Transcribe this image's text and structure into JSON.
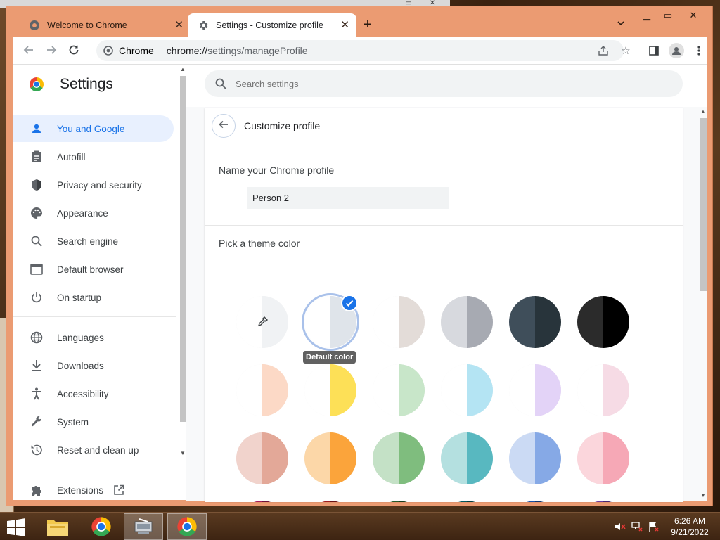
{
  "browser": {
    "tabs": [
      {
        "title": "Welcome to Chrome",
        "active": false
      },
      {
        "title": "Settings - Customize profile",
        "active": true
      }
    ],
    "omnibox": {
      "site": "Chrome",
      "url_scheme": "chrome://",
      "url_path": "settings/manageProfile"
    }
  },
  "settings": {
    "title": "Settings",
    "search_placeholder": "Search settings",
    "nav": [
      {
        "label": "You and Google",
        "icon": "person-icon",
        "selected": true
      },
      {
        "label": "Autofill",
        "icon": "clipboard-icon"
      },
      {
        "label": "Privacy and security",
        "icon": "shield-icon"
      },
      {
        "label": "Appearance",
        "icon": "palette-icon"
      },
      {
        "label": "Search engine",
        "icon": "search-icon"
      },
      {
        "label": "Default browser",
        "icon": "browser-icon"
      },
      {
        "label": "On startup",
        "icon": "power-icon"
      },
      {
        "label": "Languages",
        "icon": "globe-icon"
      },
      {
        "label": "Downloads",
        "icon": "download-icon"
      },
      {
        "label": "Accessibility",
        "icon": "accessibility-icon"
      },
      {
        "label": "System",
        "icon": "wrench-icon"
      },
      {
        "label": "Reset and clean up",
        "icon": "history-icon"
      },
      {
        "label": "Extensions",
        "icon": "puzzle-icon"
      }
    ]
  },
  "customize": {
    "title": "Customize profile",
    "name_label": "Name your Chrome profile",
    "name_value": "Person 2",
    "theme_label": "Pick a theme color",
    "tooltip": "Default color",
    "swatches": [
      {
        "name": "custom",
        "left": "#ffffff",
        "right": "#f0f2f4"
      },
      {
        "name": "default",
        "left": "#ffffff",
        "right": "#dfe4ea",
        "selected": true
      },
      {
        "name": "warm-grey",
        "left": "#ffffff",
        "right": "#e3dcd8"
      },
      {
        "name": "grey",
        "left": "#d7d9de",
        "right": "#a7aab2"
      },
      {
        "name": "blue-grey",
        "left": "#3f4e5a",
        "right": "#28343b"
      },
      {
        "name": "black",
        "left": "#2b2b2b",
        "right": "#000000"
      },
      {
        "name": "peach-light",
        "left": "#ffffff",
        "right": "#fcd9c6"
      },
      {
        "name": "yellow-light",
        "left": "#ffffff",
        "right": "#fde057"
      },
      {
        "name": "green-light",
        "left": "#ffffff",
        "right": "#c8e6c9"
      },
      {
        "name": "cyan-light",
        "left": "#ffffff",
        "right": "#b4e4f3"
      },
      {
        "name": "lavender-light",
        "left": "#ffffff",
        "right": "#e3d3f7"
      },
      {
        "name": "pink-light",
        "left": "#ffffff",
        "right": "#f6dbe5"
      },
      {
        "name": "salmon",
        "left": "#f1d3cc",
        "right": "#e3a898"
      },
      {
        "name": "orange",
        "left": "#fcd7a8",
        "right": "#fba43b"
      },
      {
        "name": "green",
        "left": "#c4e1c6",
        "right": "#7fbd7e"
      },
      {
        "name": "teal",
        "left": "#b4e0e0",
        "right": "#58b8c0"
      },
      {
        "name": "blue",
        "left": "#cbdaf4",
        "right": "#86a9e6"
      },
      {
        "name": "pink",
        "left": "#fbd6dc",
        "right": "#f6a8b6"
      },
      {
        "name": "magenta",
        "left": "#a3195b",
        "right": "#6d1238"
      },
      {
        "name": "red",
        "left": "#9e1b1e",
        "right": "#6b1214"
      },
      {
        "name": "dark-green",
        "left": "#24592a",
        "right": "#183b1c"
      },
      {
        "name": "dark-teal",
        "left": "#00575e",
        "right": "#003b3f"
      },
      {
        "name": "navy",
        "left": "#174ea6",
        "right": "#0d3470"
      },
      {
        "name": "purple",
        "left": "#6a3aa0",
        "right": "#472770"
      }
    ]
  },
  "taskbar": {
    "apps": [
      "explorer",
      "chrome",
      "network-share",
      "chrome"
    ],
    "time": "6:26 AM",
    "date": "9/21/2022"
  },
  "colors": {
    "accent": "#1a73e8",
    "frame": "#eb9b72"
  }
}
